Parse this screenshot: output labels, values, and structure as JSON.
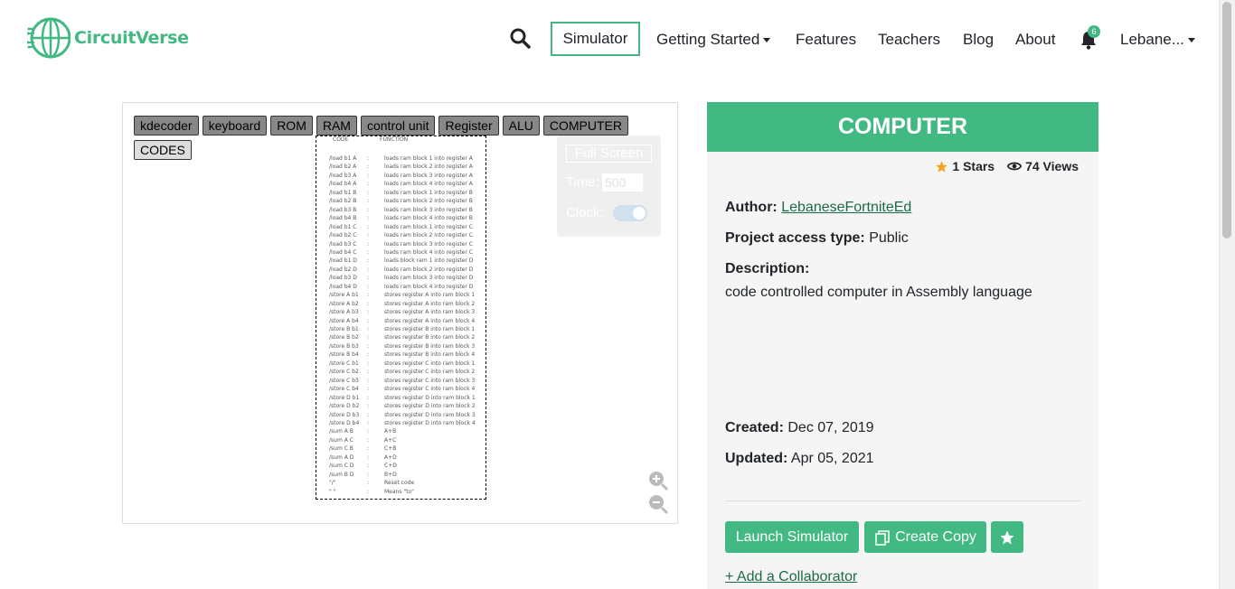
{
  "nav": {
    "brand": "CircuitVerse",
    "simulator": "Simulator",
    "getting_started": "Getting Started",
    "features": "Features",
    "teachers": "Teachers",
    "blog": "Blog",
    "about": "About",
    "notification_count": "6",
    "user": "Lebane..."
  },
  "simulator": {
    "tabs": [
      "kdecoder",
      "keyboard",
      "ROM",
      "RAM",
      "control unit",
      "Register",
      "ALU",
      "COMPUTER",
      "CODES"
    ],
    "codes_header": {
      "code": "CODE",
      "function": "FUNCTION"
    },
    "codes": [
      [
        "/load b1 A",
        ":",
        "loads ram block 1 into register A"
      ],
      [
        "/load b2 A",
        ":",
        "loads ram block 2 into register A"
      ],
      [
        "/load b3 A",
        ":",
        "loads ram block 3 into register A"
      ],
      [
        "/load b4 A",
        ":",
        "loads ram block 4 into register A"
      ],
      [
        "/load b1 B",
        ":",
        "loads ram block 1 into register B"
      ],
      [
        "/load b2 B",
        ":",
        "loads ram block 2 into register B"
      ],
      [
        "/load b3 B",
        ":",
        "loads ram block 3 into register B"
      ],
      [
        "/load b4 B",
        ":",
        "loads ram block 4 into register B"
      ],
      [
        "/load b1 C",
        ":",
        "loads ram block 1 into register C"
      ],
      [
        "/load b2 C",
        ":",
        "loads ram block 2 into register C"
      ],
      [
        "/load b3 C",
        ":",
        "loads ram block 3 into register C"
      ],
      [
        "/load b4 C",
        ":",
        "loads ram block 4 into register C"
      ],
      [
        "/load b1 D",
        ":",
        "loads block ram 1 into register D"
      ],
      [
        "/load b2 D",
        ":",
        "loads ram block 2 into register D"
      ],
      [
        "/load b3 D",
        ":",
        "loads ram block 3 into register D"
      ],
      [
        "/load b4 D",
        ":",
        "loads ram block 4 into register D"
      ],
      [
        "/store A b1",
        ":",
        "stores register A into ram block 1"
      ],
      [
        "/store A b2",
        ":",
        "stores register A into ram block 2"
      ],
      [
        "/store A b3",
        ":",
        "stores register A into ram block 3"
      ],
      [
        "/store A b4",
        ":",
        "stores register A into ram block 4"
      ],
      [
        "/store B b1",
        ":",
        "stores register B into ram block 1"
      ],
      [
        "/store B b2",
        ":",
        "stores register B into ram block 2"
      ],
      [
        "/store B b3",
        ":",
        "stores register B into ram block 3"
      ],
      [
        "/store B b4",
        ":",
        "stores register B into ram block 4"
      ],
      [
        "/store C b1",
        ":",
        "stores register C into ram block 1"
      ],
      [
        "/store C b2",
        ":",
        "stores register C into ram block 2"
      ],
      [
        "/store C b3",
        ":",
        "stores register C into ram block 3"
      ],
      [
        "/store C b4",
        ":",
        "stores register C into ram block 4"
      ],
      [
        "/store D b1",
        ":",
        "stores register D into ram block 1"
      ],
      [
        "/store D b2",
        ":",
        "stores register D into ram block 2"
      ],
      [
        "/store D b3",
        ":",
        "stores register D into ram block 3"
      ],
      [
        "/store D b4",
        ":",
        "stores register D into ram block 4"
      ],
      [
        "/sum A B",
        ":",
        "A+B"
      ],
      [
        "/sum A C",
        ":",
        "A+C"
      ],
      [
        "/sum C B",
        ":",
        "C+B"
      ],
      [
        "/sum A D",
        ":",
        "A+D"
      ],
      [
        "/sum C D",
        ":",
        "C+D"
      ],
      [
        "/sum B D",
        ":",
        "B+D"
      ],
      [
        "\"/\"",
        ":",
        "Reset code"
      ],
      [
        "\" \"",
        ":",
        "Means \"to\""
      ]
    ],
    "full_screen": "Full Screen",
    "time_label": "Time:",
    "time_value": "500",
    "clock_label": "Clock:"
  },
  "project": {
    "title": "COMPUTER",
    "stars": "1 Stars",
    "views": "74 Views",
    "author_label": "Author:",
    "author": "LebaneseFortniteEd",
    "access_label": "Project access type:",
    "access": "Public",
    "description_label": "Description:",
    "description": "code controlled computer in Assembly language",
    "created_label": "Created:",
    "created": "Dec 07, 2019",
    "updated_label": "Updated:",
    "updated": "Apr 05, 2021",
    "launch": "Launch Simulator",
    "copy": "Create Copy",
    "add_collaborator": "+ Add a Collaborator"
  },
  "colors": {
    "accent": "#42b983",
    "link": "#1c6b48",
    "star": "#f5a623"
  }
}
